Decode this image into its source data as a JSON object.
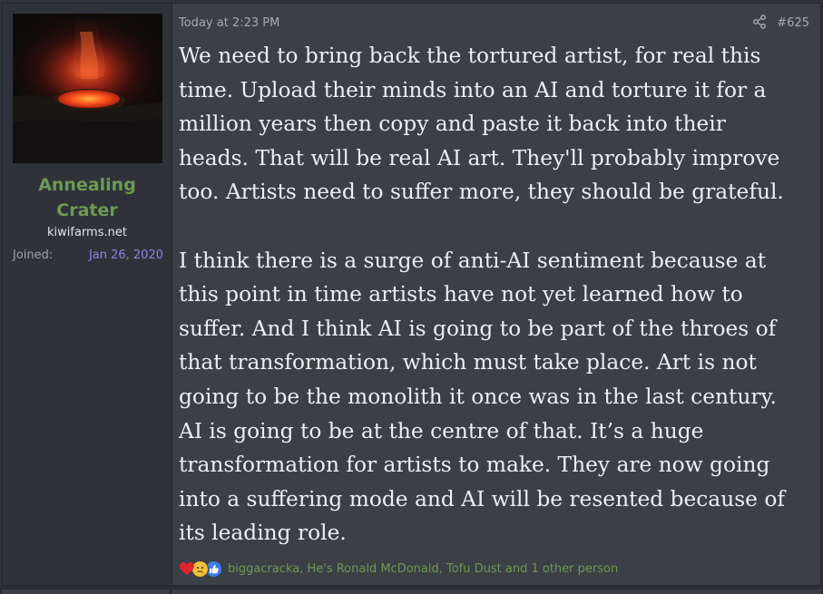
{
  "user": {
    "name": "Annealing Crater",
    "name_line1": "Annealing",
    "name_line2": "Crater",
    "title": "kiwifarms.net",
    "joined_label": "Joined:",
    "joined_date": "Jan 26, 2020"
  },
  "post": {
    "timestamp": "Today at 2:23 PM",
    "number": "#625",
    "paragraph1_lines": [
      "We need to bring back the tortured artist, for real this",
      "time. Upload their minds into an AI and torture it for a",
      "million years then copy and paste it back into their",
      "heads. That will be real AI art. They'll probably improve",
      "too. Artists need to suffer more, they should be grateful."
    ],
    "paragraph2_lines": [
      "I think there is a surge of anti-AI sentiment because at",
      "this point in time artists have not yet learned how to",
      "suffer. And I think AI is going to be part of the throes of",
      "that transformation, which must take place. Art is not",
      "going to be the monolith it once was in the last century.",
      "AI is going to be at the centre of that. It’s a huge",
      "transformation for artists to make. They are now going",
      "into a suffering mode and AI will be resented because of",
      "its leading role."
    ]
  },
  "reactions": {
    "icons": [
      "heart-icon",
      "thinking-face-icon",
      "thumbs-up-icon"
    ],
    "users_text": "biggacracka, He's Ronald McDonald, Tofu Dust and 1 other person"
  },
  "colors": {
    "username": "#6d9a52",
    "joined_date": "#8a86e8",
    "post_background": "#3b3f46",
    "user_cell_background": "#2f3339",
    "message_text": "#eceef0"
  }
}
